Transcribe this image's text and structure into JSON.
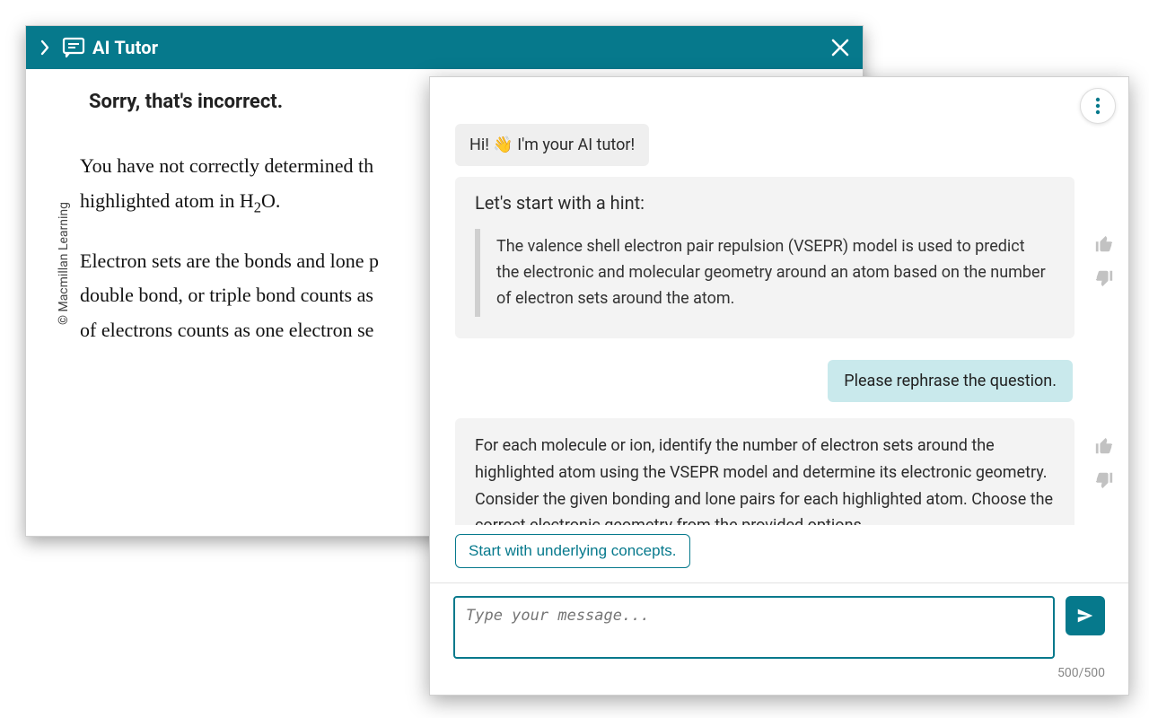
{
  "header": {
    "title": "AI Tutor"
  },
  "feedback": {
    "sorry": "Sorry, that's incorrect.",
    "p1_a": "You have not correctly determined th",
    "p1_b": "highlighted atom in H",
    "p1_sub": "2",
    "p1_c": "O.",
    "p2_a": "Electron sets are the bonds and lone p",
    "p2_b": "double bond, or triple bond counts as",
    "p2_c": "of electrons counts as one electron se",
    "copyright": "© Macmillan Learning"
  },
  "chat": {
    "intro": "Hi! 👋 I'm your AI tutor!",
    "hint_lead": "Let's start with a hint:",
    "hint_body": "The valence shell electron pair repulsion (VSEPR) model is used to predict the electronic and molecular geometry around an atom based on the number of electron sets around the atom.",
    "user_message": "Please rephrase the question.",
    "rephrase": "For each molecule or ion, identify the number of electron sets around the highlighted atom using the VSEPR model and determine its electronic geometry. Consider the given bonding and lone pairs for each highlighted atom. Choose the correct electronic geometry from the provided options.",
    "suggestion": "Start with underlying concepts.",
    "input_placeholder": "Type your message...",
    "counter": "500/500"
  }
}
